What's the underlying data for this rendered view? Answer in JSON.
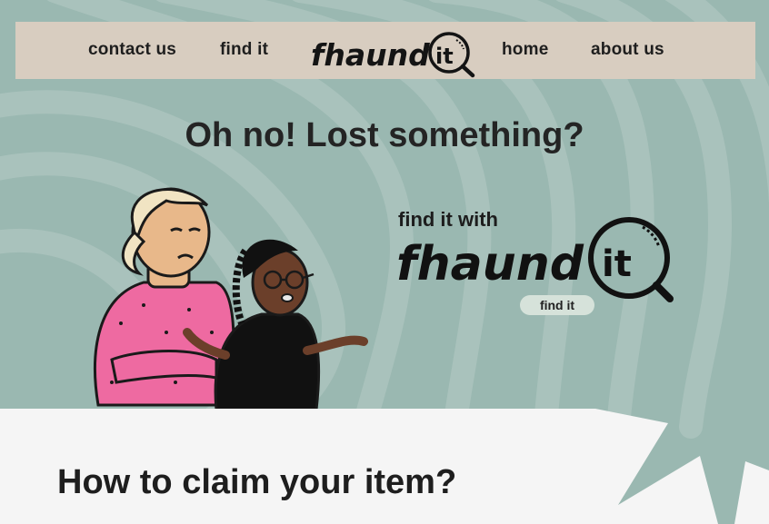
{
  "nav": {
    "links": [
      {
        "label": "contact us"
      },
      {
        "label": "find it"
      },
      {
        "label": "home"
      },
      {
        "label": "about us"
      }
    ],
    "logo": {
      "text": "fhaund",
      "suffix": "it"
    }
  },
  "hero": {
    "title": "Oh no! Lost something?",
    "tagline": "find it with",
    "logo": {
      "text": "fhaund",
      "suffix": "it"
    },
    "button_label": "find it"
  },
  "claim_section": {
    "heading": "How to claim your item?"
  },
  "colors": {
    "background": "#9ab8b1",
    "wave": "#a9c2bc",
    "navbar": "#d8cdc0",
    "panel": "#f5f5f5",
    "button": "#d6e2da",
    "text": "#1e1e1e"
  },
  "icons": [
    "magnifier-icon"
  ]
}
